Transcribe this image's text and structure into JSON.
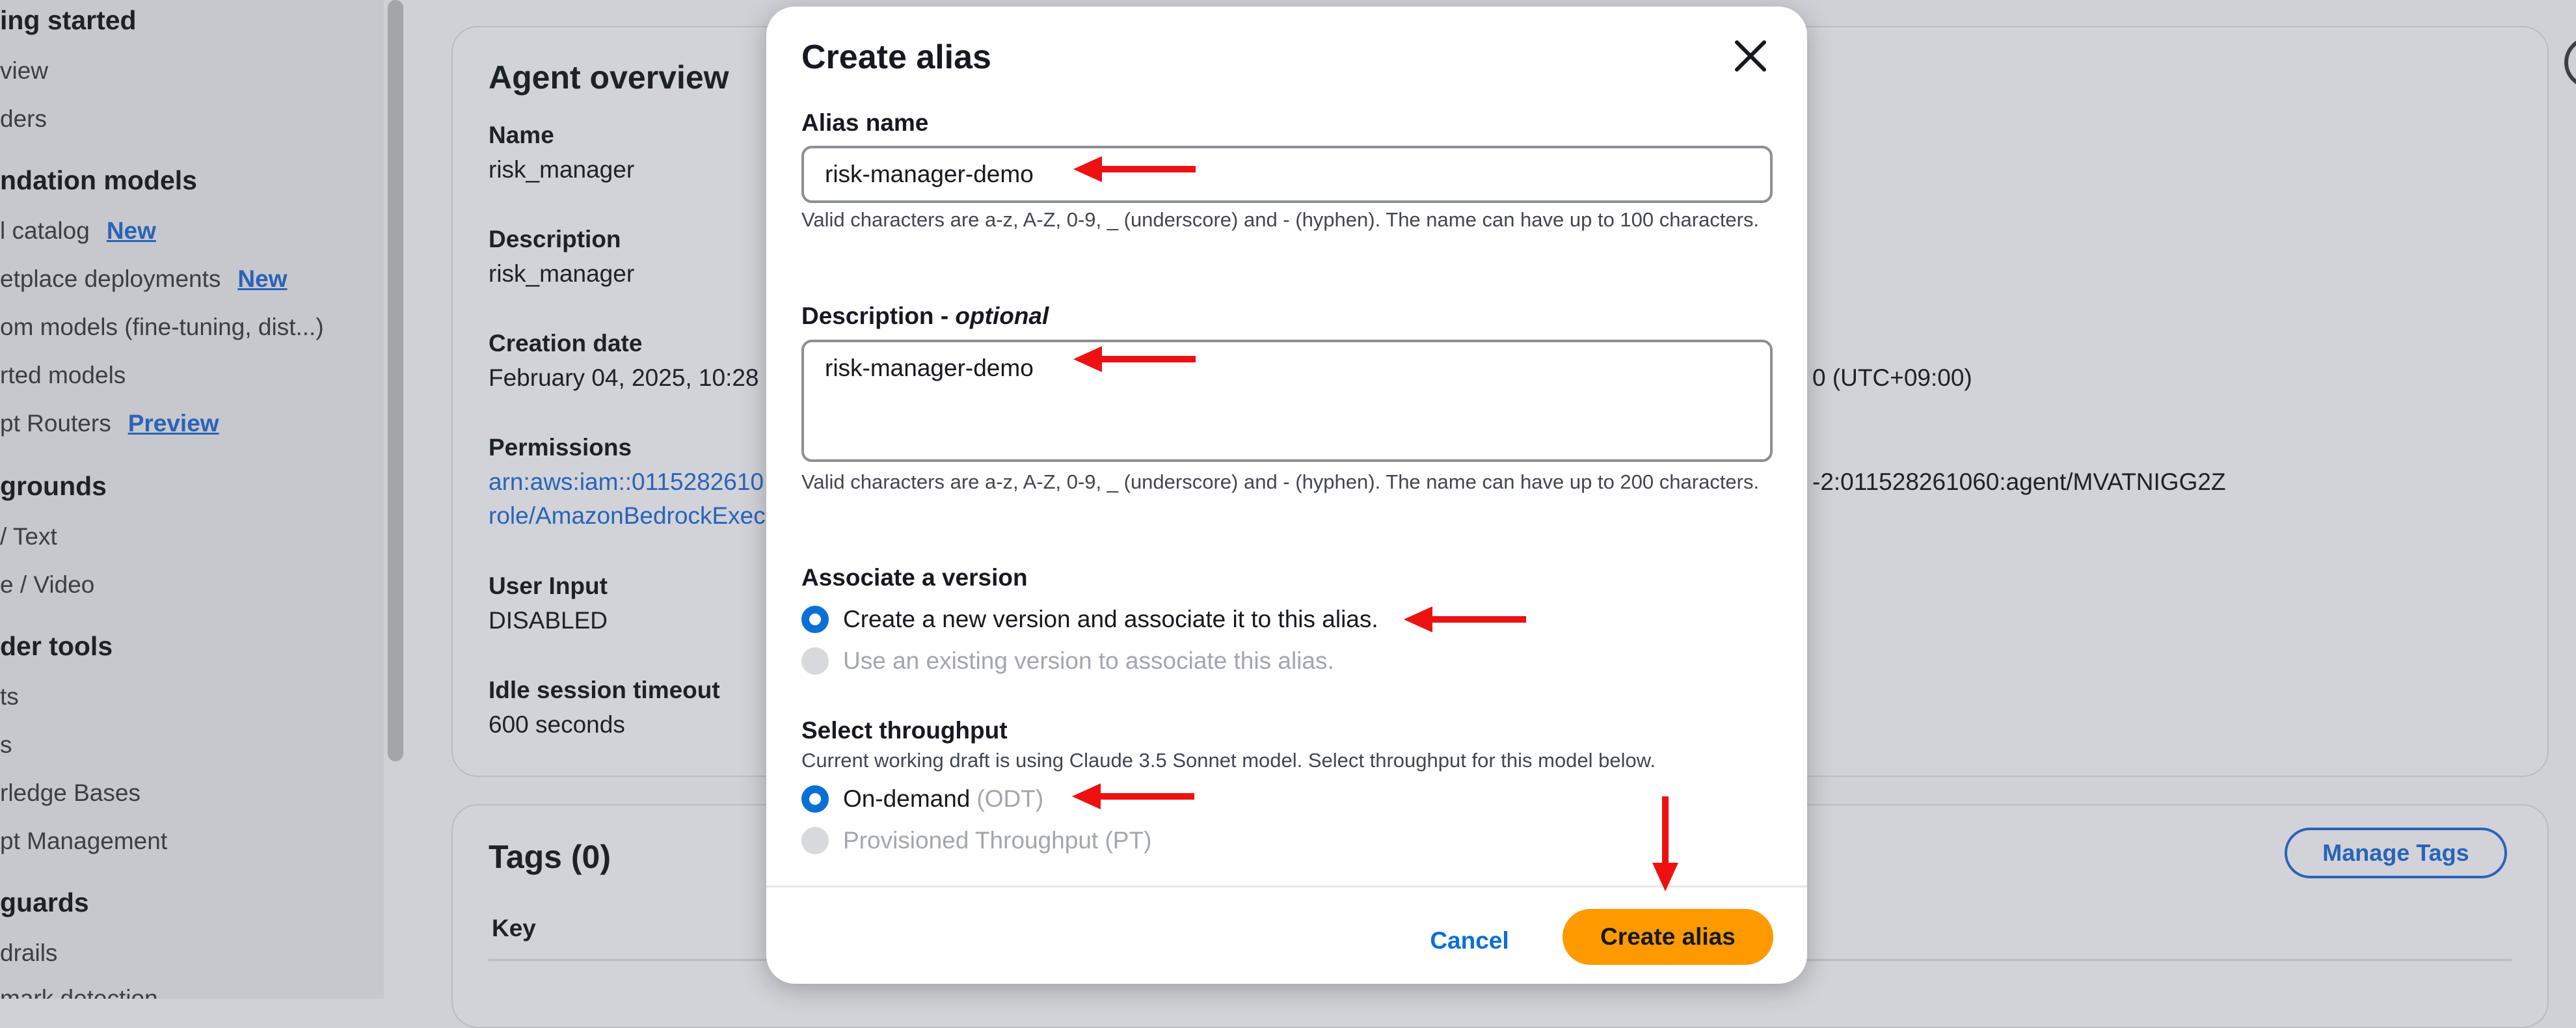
{
  "sidebar": {
    "items": [
      {
        "label": "ing started",
        "heading": true
      },
      {
        "label": "view"
      },
      {
        "label": "ders"
      },
      {
        "label": "ndation models",
        "heading": true
      },
      {
        "label": "l catalog",
        "badge": "New"
      },
      {
        "label": "etplace deployments",
        "badge": "New"
      },
      {
        "label": "om models (fine-tuning, dist...)"
      },
      {
        "label": "rted models"
      },
      {
        "label": "pt Routers",
        "badge": "Preview"
      },
      {
        "label": "grounds",
        "heading": true
      },
      {
        "label": "/ Text"
      },
      {
        "label": "e / Video"
      },
      {
        "label": "der tools",
        "heading": true
      },
      {
        "label": "ts"
      },
      {
        "label": "s"
      },
      {
        "label": "rledge Bases"
      },
      {
        "label": "pt Management"
      },
      {
        "label": "guards",
        "heading": true
      },
      {
        "label": "drails"
      },
      {
        "label": "mark detection"
      }
    ]
  },
  "overview": {
    "title": "Agent overview",
    "name_label": "Name",
    "name_value": "risk_manager",
    "description_label": "Description",
    "description_value": "risk_manager",
    "creation_label": "Creation date",
    "creation_value": "February 04, 2025, 10:28",
    "creation_value_right": "0 (UTC+09:00)",
    "permissions_label": "Permissions",
    "permissions_line1": "arn:aws:iam::0115282610",
    "permissions_line2": "role/AmazonBedrockExec",
    "arn_right": "-2:011528261060:agent/MVATNIGG2Z",
    "user_input_label": "User Input",
    "user_input_value": "DISABLED",
    "idle_label": "Idle session timeout",
    "idle_value": "600 seconds"
  },
  "tags": {
    "title": "Tags (0)",
    "manage_label": "Manage Tags",
    "key_header": "Key"
  },
  "modal": {
    "title": "Create alias",
    "alias_label": "Alias name",
    "alias_value": "risk-manager-demo",
    "alias_help": "Valid characters are a-z, A-Z, 0-9, _ (underscore) and - (hyphen). The name can have up to 100 characters.",
    "desc_label": "Description - ",
    "desc_optional": "optional",
    "desc_value": "risk-manager-demo",
    "desc_help": "Valid characters are a-z, A-Z, 0-9, _ (underscore) and - (hyphen). The name can have up to 200 characters.",
    "version_label": "Associate a version",
    "version_options": [
      {
        "label": "Create a new version and associate it to this alias.",
        "selected": true,
        "disabled": false
      },
      {
        "label": "Use an existing version to associate this alias.",
        "selected": false,
        "disabled": true
      }
    ],
    "throughput_label": "Select throughput",
    "throughput_help": "Current working draft is using Claude 3.5 Sonnet model. Select throughput for this model below.",
    "throughput_options": [
      {
        "label": "On-demand",
        "suffix": "(ODT)",
        "selected": true,
        "disabled": false
      },
      {
        "label": "Provisioned Throughput (PT)",
        "suffix": "",
        "selected": false,
        "disabled": true
      }
    ],
    "cancel_label": "Cancel",
    "create_label": "Create alias"
  },
  "colors": {
    "primary_button": "#ff9900",
    "link": "#0b6fd6",
    "annotation_arrow": "#ee1111"
  }
}
